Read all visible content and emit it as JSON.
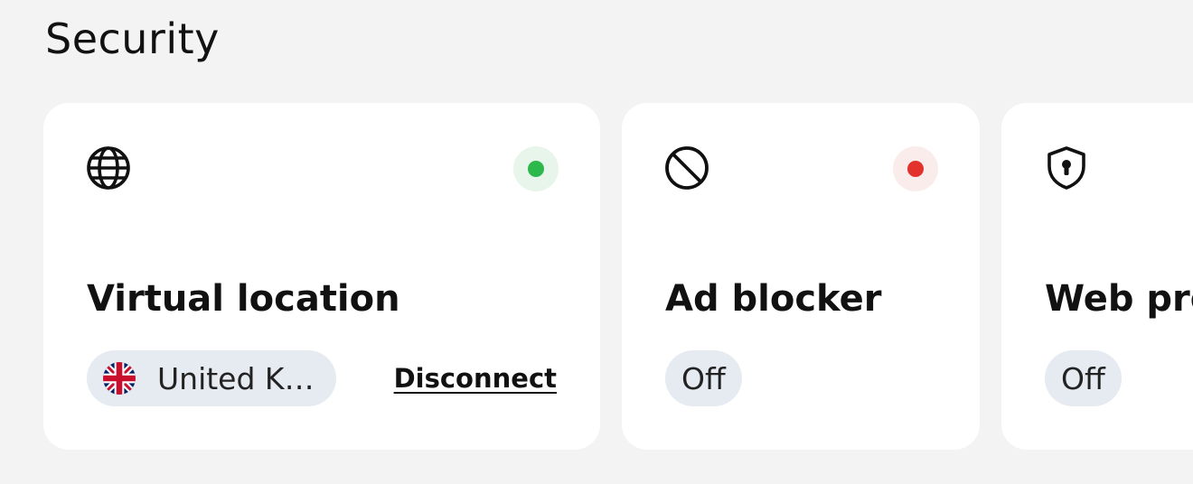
{
  "section": {
    "title": "Security"
  },
  "cards": [
    {
      "icon": "globe-icon",
      "title": "Virtual location",
      "status": "on",
      "status_color": "#2db84b",
      "location": "United Kingdom",
      "location_flag": "uk-flag-icon",
      "action_label": "Disconnect"
    },
    {
      "icon": "ban-icon",
      "title": "Ad blocker",
      "status": "off",
      "status_color": "#e3322c",
      "state_label": "Off"
    },
    {
      "icon": "shield-lock-icon",
      "title": "Web protection",
      "state_label": "Off"
    }
  ]
}
